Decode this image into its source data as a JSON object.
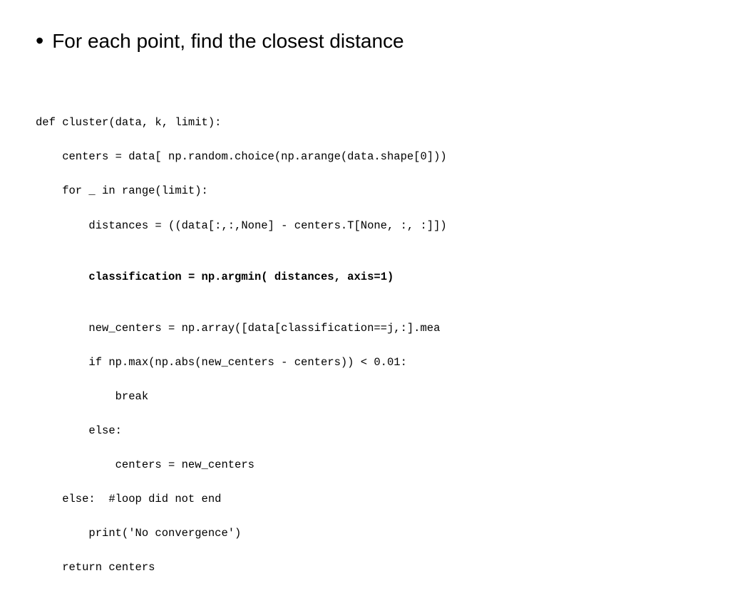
{
  "slide": {
    "bullet": {
      "dot": "•",
      "text": "For each point, find the closest distance"
    },
    "code": {
      "line1": "def cluster(data, k, limit):",
      "line2": "    centers = data[ np.random.choice(np.arange(data.shape[0]))",
      "line3": "    for _ in range(limit):",
      "line4": "        distances = ((data[:,:",
      "line4b": ",None] - centers.T[None, :, :])",
      "line5_normal": "        ",
      "line5_bold": "classification = np.argmin( distances, axis=1)",
      "line6": "        new_centers = np.array([data[classification==j,:].mea",
      "line7": "        if np.max(np.abs(new_centers - centers)) < 0.01:",
      "line8": "            break",
      "line9": "        else:",
      "line10": "            centers = new_centers",
      "line11": "    else:  #loop did not end",
      "line12": "        print('No convergence')",
      "line13": "    return centers"
    }
  }
}
